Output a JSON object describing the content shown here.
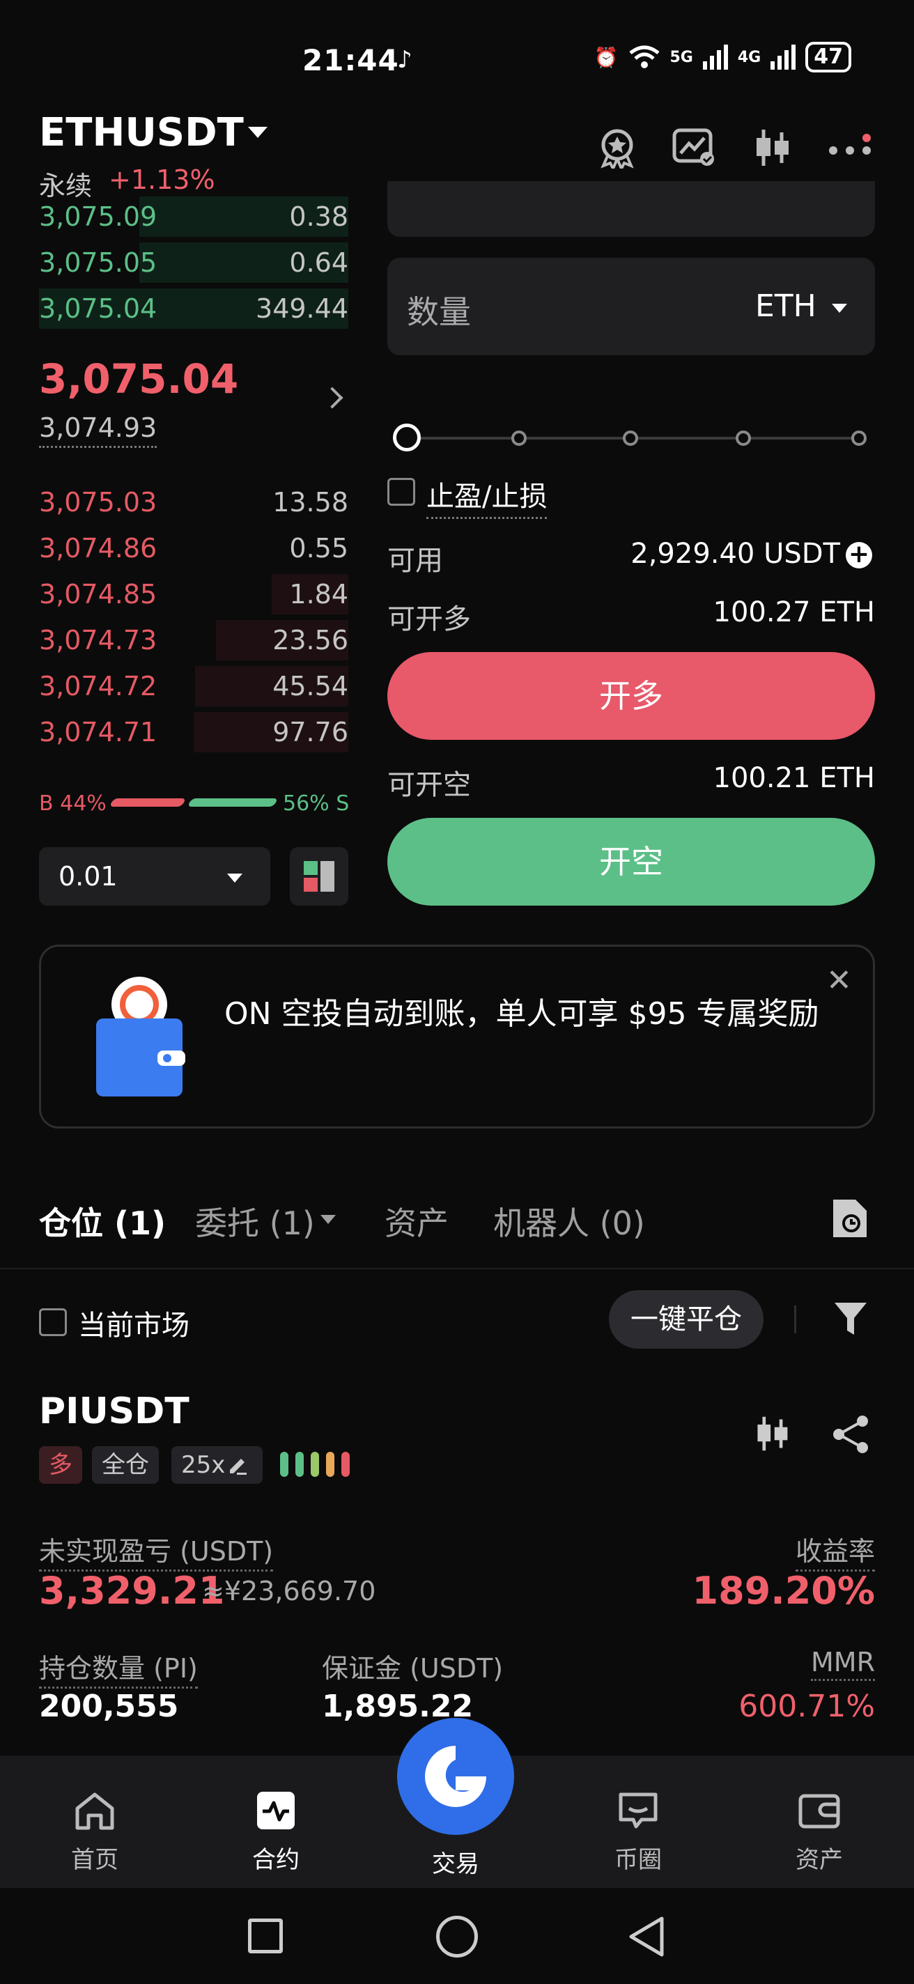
{
  "status_bar": {
    "time": "21:44",
    "battery": "47",
    "net1": "5G",
    "net2": "4G"
  },
  "header": {
    "symbol": "ETHUSDT",
    "type": "永续",
    "change": "+1.13%"
  },
  "orderbook": {
    "asks": [
      {
        "price": "3,075.09",
        "qty": "0.38"
      },
      {
        "price": "3,075.05",
        "qty": "0.64"
      },
      {
        "price": "3,075.04",
        "qty": "349.44"
      }
    ],
    "last_price": "3,075.04",
    "mark_price": "3,074.93",
    "bids": [
      {
        "price": "3,075.03",
        "qty": "13.58"
      },
      {
        "price": "3,074.86",
        "qty": "0.55"
      },
      {
        "price": "3,074.85",
        "qty": "1.84"
      },
      {
        "price": "3,074.73",
        "qty": "23.56"
      },
      {
        "price": "3,074.72",
        "qty": "45.54"
      },
      {
        "price": "3,074.71",
        "qty": "97.76"
      }
    ],
    "buy_ratio": "B 44%",
    "sell_ratio": "56% S",
    "precision": "0.01"
  },
  "order_form": {
    "qty_label": "数量",
    "qty_unit": "ETH",
    "tpsl_label": "止盈/止损",
    "available_label": "可用",
    "available_value": "2,929.40 USDT",
    "max_long_label": "可开多",
    "max_long_value": "100.27 ETH",
    "long_button": "开多",
    "max_short_label": "可开空",
    "max_short_value": "100.21 ETH",
    "short_button": "开空"
  },
  "banner": {
    "text": "ON 空投自动到账，单人可享 $95 专属奖励"
  },
  "tabs": [
    {
      "label": "仓位 (1)"
    },
    {
      "label": "委托 (1)"
    },
    {
      "label": "资产"
    },
    {
      "label": "机器人 (0)"
    }
  ],
  "filter": {
    "current_market": "当前市场",
    "close_all": "一键平仓"
  },
  "position": {
    "symbol": "PIUSDT",
    "side": "多",
    "margin_mode": "全仓",
    "leverage": "25x",
    "pnl_label": "未实现盈亏 (USDT)",
    "pnl_value": "3,329.21",
    "pnl_cny": "≈¥23,669.70",
    "roe_label": "收益率",
    "roe_value": "189.20%",
    "size_label": "持仓数量 (PI)",
    "size_value": "200,555",
    "margin_label": "保证金 (USDT)",
    "margin_value": "1,895.22",
    "mmr_label": "MMR",
    "mmr_value": "600.71%"
  },
  "bottom_nav": [
    {
      "label": "首页",
      "icon": "home-icon"
    },
    {
      "label": "合约",
      "icon": "futures-icon"
    },
    {
      "label": "交易",
      "icon": "trade-icon"
    },
    {
      "label": "币圈",
      "icon": "community-icon"
    },
    {
      "label": "资产",
      "icon": "wallet-icon"
    }
  ],
  "colors": {
    "red": "#e65a64",
    "green": "#5cbf87",
    "accent": "#2f6ee8",
    "background": "#0b0b0b"
  }
}
